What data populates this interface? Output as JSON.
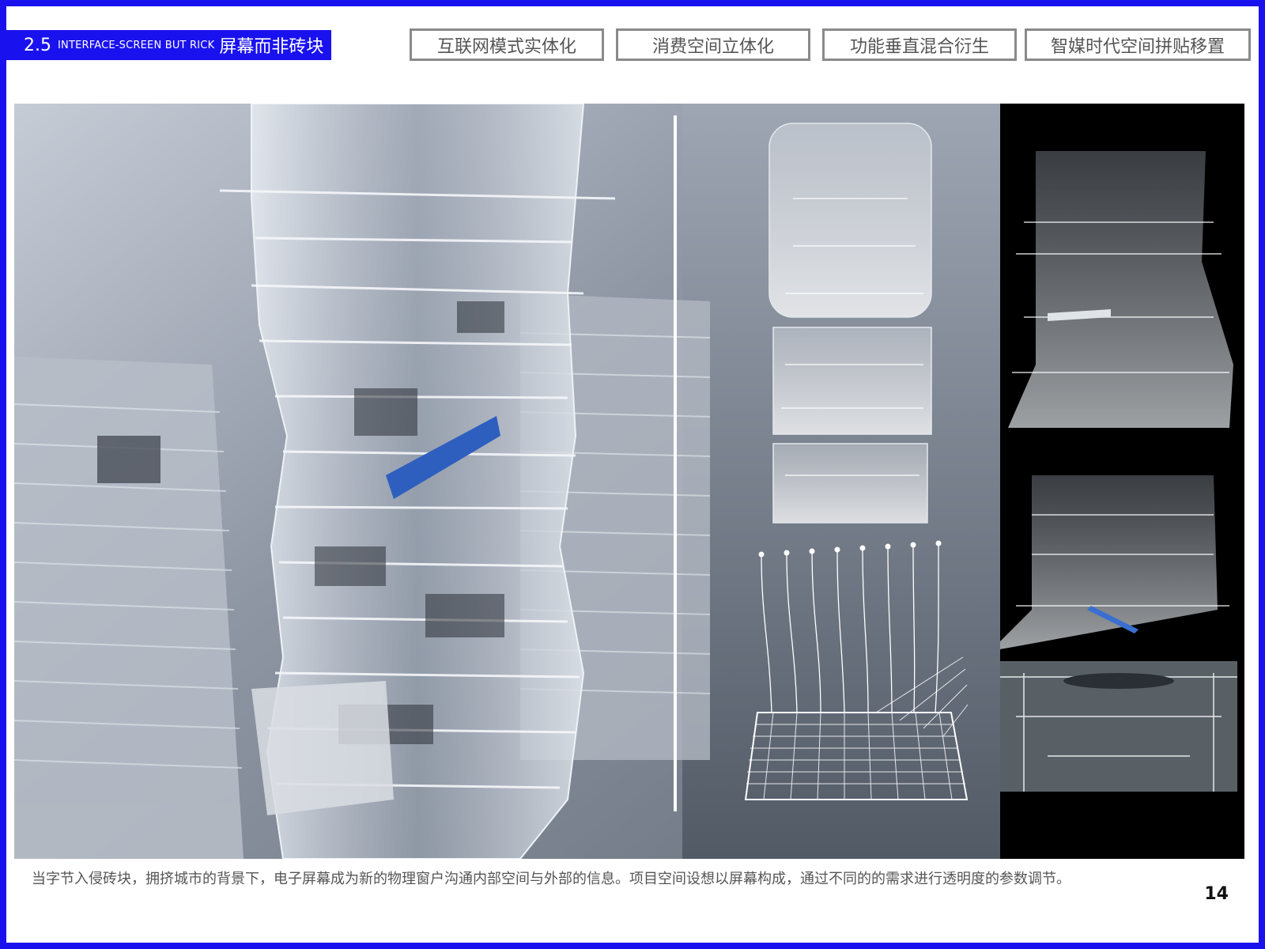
{
  "header": {
    "section_number": "2.5",
    "section_title_en": "INTERFACE-SCREEN BUT RICK",
    "section_title_cn": "屏幕而非砖块",
    "accent_color": "#1a12ee"
  },
  "tabs": [
    {
      "label": "互联网模式实体化"
    },
    {
      "label": "消费空间立体化"
    },
    {
      "label": "功能垂直混合衍生"
    },
    {
      "label": "智媒时代空间拼贴移置"
    }
  ],
  "images": {
    "hero": "glass-tower-rendering",
    "sections": "tower-section-diagrams",
    "screen_grid": "screen-parameter-diagram",
    "night_views": "night-section-renderings"
  },
  "caption": "当字节入侵砖块，拥挤城市的背景下，电子屏幕成为新的物理窗户沟通内部空间与外部的信息。项目空间设想以屏幕构成，通过不同的的需求进行透明度的参数调节。",
  "page_number": "14"
}
